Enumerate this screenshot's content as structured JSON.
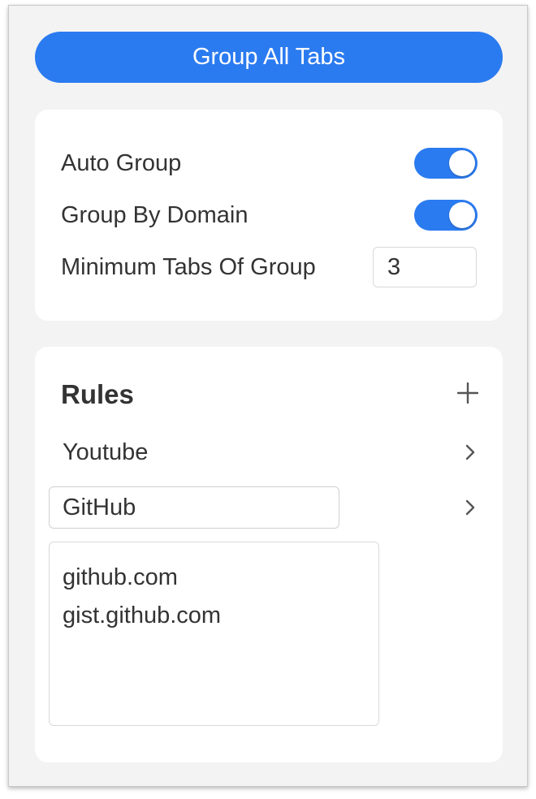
{
  "header": {
    "group_all_label": "Group All Tabs"
  },
  "settings": {
    "auto_group": {
      "label": "Auto Group",
      "enabled": true
    },
    "group_by_domain": {
      "label": "Group By Domain",
      "enabled": true
    },
    "min_tabs": {
      "label": "Minimum Tabs Of Group",
      "value": "3"
    }
  },
  "rules": {
    "title": "Rules",
    "add_icon": "plus-icon",
    "items": [
      {
        "name": "Youtube",
        "editing": false,
        "icon": "chevron-right-icon"
      },
      {
        "name": "GitHub",
        "editing": true,
        "icon": "chevron-right-icon"
      }
    ],
    "editing_domains": "github.com\ngist.github.com"
  },
  "colors": {
    "accent": "#2b7bf0",
    "background": "#f3f3f3",
    "card": "#ffffff",
    "text": "#333333"
  }
}
